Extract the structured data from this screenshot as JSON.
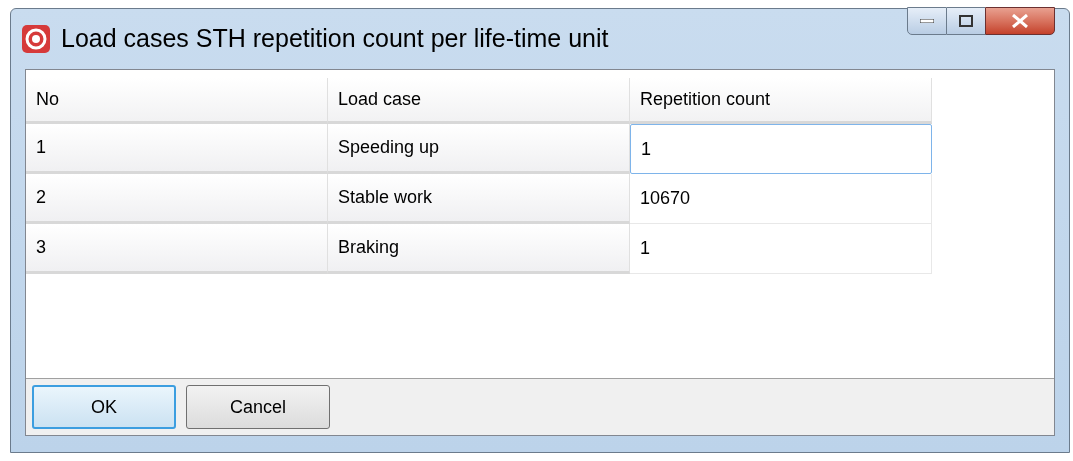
{
  "window": {
    "title": "Load cases STH repetition count per life-time unit"
  },
  "table": {
    "columns": [
      "No",
      "Load case",
      "Repetition count"
    ],
    "rows": [
      {
        "cells": [
          "1",
          "Speeding up",
          "1"
        ],
        "focused": true
      },
      {
        "cells": [
          "2",
          "Stable work",
          "10670"
        ],
        "focused": false
      },
      {
        "cells": [
          "3",
          "Braking",
          "1"
        ],
        "focused": false
      }
    ]
  },
  "buttons": [
    {
      "label": "OK",
      "default": true
    },
    {
      "label": "Cancel",
      "default": false
    }
  ]
}
